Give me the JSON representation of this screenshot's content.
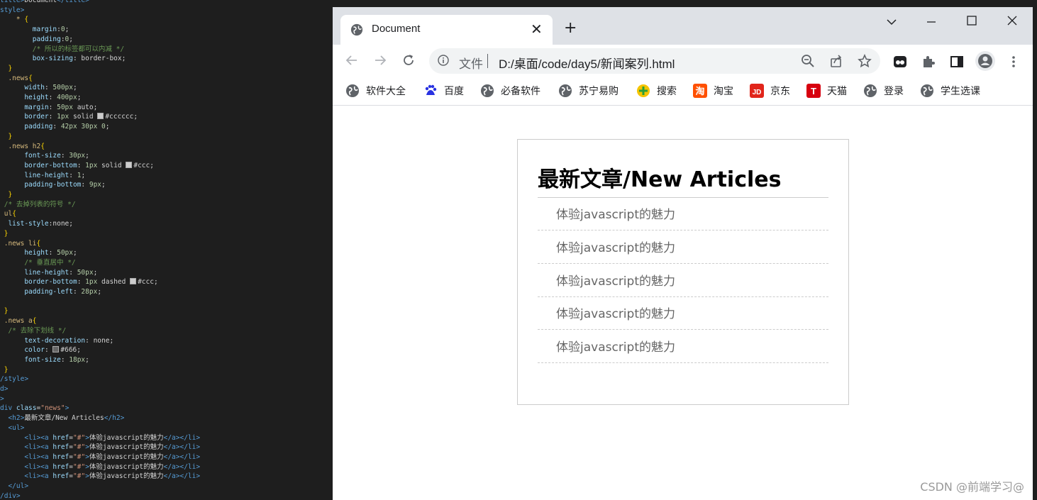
{
  "editor": {
    "lines": [
      [
        [
          "c-tag",
          "title>"
        ],
        [
          "c-txt",
          "Document"
        ],
        [
          "c-tag",
          "</title>"
        ]
      ],
      [
        [
          "c-tag",
          "style>"
        ]
      ],
      [
        [
          "c-txt",
          "    "
        ],
        [
          "c-sel",
          "* "
        ],
        [
          "c-brace",
          "{"
        ]
      ],
      [
        [
          "c-txt",
          "        "
        ],
        [
          "c-prop",
          "margin"
        ],
        [
          "c-txt",
          ":"
        ],
        [
          "c-num",
          "0"
        ],
        [
          "c-txt",
          ";"
        ]
      ],
      [
        [
          "c-txt",
          "        "
        ],
        [
          "c-prop",
          "padding"
        ],
        [
          "c-txt",
          ":"
        ],
        [
          "c-num",
          "0"
        ],
        [
          "c-txt",
          ";"
        ]
      ],
      [
        [
          "c-txt",
          "        "
        ],
        [
          "c-com",
          "/* 所以的标签都可以内减 */"
        ]
      ],
      [
        [
          "c-txt",
          "        "
        ],
        [
          "c-prop",
          "box-sizing"
        ],
        [
          "c-txt",
          ": border-box;"
        ]
      ],
      [
        [
          "c-txt",
          "  "
        ],
        [
          "c-brace",
          "}"
        ]
      ],
      [
        [
          "c-txt",
          "  "
        ],
        [
          "c-sel",
          ".news"
        ],
        [
          "c-brace",
          "{"
        ]
      ],
      [
        [
          "c-txt",
          "      "
        ],
        [
          "c-prop",
          "width"
        ],
        [
          "c-txt",
          ": "
        ],
        [
          "c-num",
          "500px"
        ],
        [
          "c-txt",
          ";"
        ]
      ],
      [
        [
          "c-txt",
          "      "
        ],
        [
          "c-prop",
          "height"
        ],
        [
          "c-txt",
          ": "
        ],
        [
          "c-num",
          "400px"
        ],
        [
          "c-txt",
          ";"
        ]
      ],
      [
        [
          "c-txt",
          "      "
        ],
        [
          "c-prop",
          "margin"
        ],
        [
          "c-txt",
          ": "
        ],
        [
          "c-num",
          "50px"
        ],
        [
          "c-txt",
          " auto;"
        ]
      ],
      [
        [
          "c-txt",
          "      "
        ],
        [
          "c-prop",
          "border"
        ],
        [
          "c-txt",
          ": "
        ],
        [
          "c-num",
          "1px"
        ],
        [
          "c-txt",
          " solid "
        ],
        [
          "swatch",
          "#cccccc"
        ],
        [
          "c-txt",
          "#cccccc;"
        ]
      ],
      [
        [
          "c-txt",
          "      "
        ],
        [
          "c-prop",
          "padding"
        ],
        [
          "c-txt",
          ": "
        ],
        [
          "c-num",
          "42px 30px 0"
        ],
        [
          "c-txt",
          ";"
        ]
      ],
      [
        [
          "c-txt",
          "  "
        ],
        [
          "c-brace",
          "}"
        ]
      ],
      [
        [
          "c-txt",
          "  "
        ],
        [
          "c-sel",
          ".news h2"
        ],
        [
          "c-brace",
          "{"
        ]
      ],
      [
        [
          "c-txt",
          "      "
        ],
        [
          "c-prop",
          "font-size"
        ],
        [
          "c-txt",
          ": "
        ],
        [
          "c-num",
          "30px"
        ],
        [
          "c-txt",
          ";"
        ]
      ],
      [
        [
          "c-txt",
          "      "
        ],
        [
          "c-prop",
          "border-bottom"
        ],
        [
          "c-txt",
          ": "
        ],
        [
          "c-num",
          "1px"
        ],
        [
          "c-txt",
          " solid "
        ],
        [
          "swatch",
          "#cccccc"
        ],
        [
          "c-txt",
          "#ccc;"
        ]
      ],
      [
        [
          "c-txt",
          "      "
        ],
        [
          "c-prop",
          "line-height"
        ],
        [
          "c-txt",
          ": "
        ],
        [
          "c-num",
          "1"
        ],
        [
          "c-txt",
          ";"
        ]
      ],
      [
        [
          "c-txt",
          "      "
        ],
        [
          "c-prop",
          "padding-bottom"
        ],
        [
          "c-txt",
          ": "
        ],
        [
          "c-num",
          "9px"
        ],
        [
          "c-txt",
          ";"
        ]
      ],
      [
        [
          "c-txt",
          "  "
        ],
        [
          "c-brace",
          "}"
        ]
      ],
      [
        [
          "c-txt",
          " "
        ],
        [
          "c-com",
          "/* 去掉列表的符号 */"
        ]
      ],
      [
        [
          "c-txt",
          " "
        ],
        [
          "c-sel",
          "ul"
        ],
        [
          "c-brace",
          "{"
        ]
      ],
      [
        [
          "c-txt",
          "  "
        ],
        [
          "c-prop",
          "list-style"
        ],
        [
          "c-txt",
          ":none;"
        ]
      ],
      [
        [
          "c-txt",
          " "
        ],
        [
          "c-brace",
          "}"
        ]
      ],
      [
        [
          "c-txt",
          " "
        ],
        [
          "c-sel",
          ".news li"
        ],
        [
          "c-brace",
          "{"
        ]
      ],
      [
        [
          "c-txt",
          "      "
        ],
        [
          "c-prop",
          "height"
        ],
        [
          "c-txt",
          ": "
        ],
        [
          "c-num",
          "50px"
        ],
        [
          "c-txt",
          ";"
        ]
      ],
      [
        [
          "c-txt",
          "      "
        ],
        [
          "c-com",
          "/* 垂直居中 */"
        ]
      ],
      [
        [
          "c-txt",
          "      "
        ],
        [
          "c-prop",
          "line-height"
        ],
        [
          "c-txt",
          ": "
        ],
        [
          "c-num",
          "50px"
        ],
        [
          "c-txt",
          ";"
        ]
      ],
      [
        [
          "c-txt",
          "      "
        ],
        [
          "c-prop",
          "border-bottom"
        ],
        [
          "c-txt",
          ": "
        ],
        [
          "c-num",
          "1px"
        ],
        [
          "c-txt",
          " dashed "
        ],
        [
          "swatch",
          "#cccccc"
        ],
        [
          "c-txt",
          "#ccc;"
        ]
      ],
      [
        [
          "c-txt",
          "      "
        ],
        [
          "c-prop",
          "padding-left"
        ],
        [
          "c-txt",
          ": "
        ],
        [
          "c-num",
          "28px"
        ],
        [
          "c-txt",
          ";"
        ]
      ],
      [
        [
          "c-txt",
          ""
        ]
      ],
      [
        [
          "c-txt",
          " "
        ],
        [
          "c-brace",
          "}"
        ]
      ],
      [
        [
          "c-txt",
          " "
        ],
        [
          "c-sel",
          ".news a"
        ],
        [
          "c-brace",
          "{"
        ]
      ],
      [
        [
          "c-txt",
          "  "
        ],
        [
          "c-com",
          "/* 去除下划线 */"
        ]
      ],
      [
        [
          "c-txt",
          "      "
        ],
        [
          "c-prop",
          "text-decoration"
        ],
        [
          "c-txt",
          ": none;"
        ]
      ],
      [
        [
          "c-txt",
          "      "
        ],
        [
          "c-prop",
          "color"
        ],
        [
          "c-txt",
          ": "
        ],
        [
          "swatch",
          "#666666"
        ],
        [
          "c-txt",
          "#666;"
        ]
      ],
      [
        [
          "c-txt",
          "      "
        ],
        [
          "c-prop",
          "font-size"
        ],
        [
          "c-txt",
          ": "
        ],
        [
          "c-num",
          "18px"
        ],
        [
          "c-txt",
          ";"
        ]
      ],
      [
        [
          "c-txt",
          " "
        ],
        [
          "c-brace",
          "}"
        ]
      ],
      [
        [
          "c-tag",
          "/style>"
        ]
      ],
      [
        [
          "c-tag",
          "d>"
        ]
      ],
      [
        [
          "c-tag",
          ">"
        ]
      ],
      [
        [
          "c-tag",
          "div "
        ],
        [
          "c-attr",
          "class"
        ],
        [
          "c-txt",
          "="
        ],
        [
          "c-val",
          "\"news\""
        ],
        [
          "c-tag",
          ">"
        ]
      ],
      [
        [
          "c-txt",
          "  "
        ],
        [
          "c-tag",
          "<h2>"
        ],
        [
          "c-txt",
          "最新文章/New Articles"
        ],
        [
          "c-tag",
          "</h2>"
        ]
      ],
      [
        [
          "c-txt",
          "  "
        ],
        [
          "c-tag",
          "<ul>"
        ]
      ],
      [
        [
          "c-txt",
          "      "
        ],
        [
          "c-tag",
          "<li><a "
        ],
        [
          "c-attr",
          "href"
        ],
        [
          "c-txt",
          "="
        ],
        [
          "c-val",
          "\"#\""
        ],
        [
          "c-tag",
          ">"
        ],
        [
          "c-txt",
          "体验javascript的魅力"
        ],
        [
          "c-tag",
          "</a></li>"
        ]
      ],
      [
        [
          "c-txt",
          "      "
        ],
        [
          "c-tag",
          "<li><a "
        ],
        [
          "c-attr",
          "href"
        ],
        [
          "c-txt",
          "="
        ],
        [
          "c-val",
          "\"#\""
        ],
        [
          "c-tag",
          ">"
        ],
        [
          "c-txt",
          "体验javascript的魅力"
        ],
        [
          "c-tag",
          "</a></li>"
        ]
      ],
      [
        [
          "c-txt",
          "      "
        ],
        [
          "c-tag",
          "<li><a "
        ],
        [
          "c-attr",
          "href"
        ],
        [
          "c-txt",
          "="
        ],
        [
          "c-val",
          "\"#\""
        ],
        [
          "c-tag",
          ">"
        ],
        [
          "c-txt",
          "体验javascript的魅力"
        ],
        [
          "c-tag",
          "</a></li>"
        ]
      ],
      [
        [
          "c-txt",
          "      "
        ],
        [
          "c-tag",
          "<li><a "
        ],
        [
          "c-attr",
          "href"
        ],
        [
          "c-txt",
          "="
        ],
        [
          "c-val",
          "\"#\""
        ],
        [
          "c-tag",
          ">"
        ],
        [
          "c-txt",
          "体验javascript的魅力"
        ],
        [
          "c-tag",
          "</a></li>"
        ]
      ],
      [
        [
          "c-txt",
          "      "
        ],
        [
          "c-tag",
          "<li><a "
        ],
        [
          "c-attr",
          "href"
        ],
        [
          "c-txt",
          "="
        ],
        [
          "c-val",
          "\"#\""
        ],
        [
          "c-tag",
          ">"
        ],
        [
          "c-txt",
          "体验javascript的魅力"
        ],
        [
          "c-tag",
          "</a></li>"
        ]
      ],
      [
        [
          "c-txt",
          "  "
        ],
        [
          "c-tag",
          "</ul>"
        ]
      ],
      [
        [
          "c-tag",
          "/div>"
        ]
      ]
    ]
  },
  "browser": {
    "tab": {
      "title": "Document",
      "favicon": "globe-icon"
    },
    "omnibox": {
      "label": "文件",
      "url": "D:/桌面/code/day5/新闻案列.html"
    },
    "bookmarks": [
      {
        "label": "软件大全",
        "icon": "globe-icon",
        "color": "#5f6368"
      },
      {
        "label": "百度",
        "icon": "baidu-icon",
        "color": "#2932e1"
      },
      {
        "label": "必备软件",
        "icon": "globe-icon",
        "color": "#5f6368"
      },
      {
        "label": "苏宁易购",
        "icon": "globe-icon",
        "color": "#5f6368"
      },
      {
        "label": "搜索",
        "icon": "search-logo-icon",
        "color": "#f5c400"
      },
      {
        "label": "淘宝",
        "icon": "taobao-icon",
        "color": "#ff5000"
      },
      {
        "label": "京东",
        "icon": "jd-icon",
        "color": "#e1251b"
      },
      {
        "label": "天猫",
        "icon": "tmall-icon",
        "color": "#d7000f"
      },
      {
        "label": "登录",
        "icon": "globe-icon",
        "color": "#5f6368"
      },
      {
        "label": "学生选课",
        "icon": "globe-icon",
        "color": "#5f6368"
      }
    ]
  },
  "page": {
    "heading": "最新文章/New Articles",
    "articles": [
      "体验javascript的魅力",
      "体验javascript的魅力",
      "体验javascript的魅力",
      "体验javascript的魅力",
      "体验javascript的魅力"
    ]
  },
  "watermark": "CSDN @前端学习@"
}
